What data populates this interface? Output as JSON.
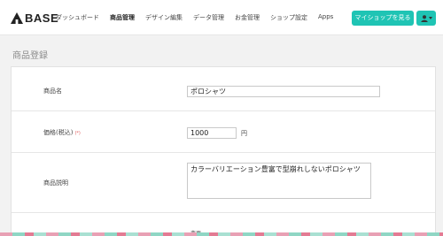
{
  "header": {
    "logo_text": "BASE",
    "nav": [
      {
        "label": "ダッシュボード",
        "active": false
      },
      {
        "label": "商品管理",
        "active": true
      },
      {
        "label": "デザイン編集",
        "active": false
      },
      {
        "label": "データ管理",
        "active": false
      },
      {
        "label": "お金管理",
        "active": false
      },
      {
        "label": "ショップ設定",
        "active": false
      },
      {
        "label": "Apps",
        "active": false
      }
    ],
    "shop_button_label": "マイショップを見る"
  },
  "page": {
    "title": "商品登録"
  },
  "form": {
    "product_name": {
      "label": "商品名",
      "value": "ポロシャツ"
    },
    "price": {
      "label": "価格(税込)",
      "required_mark": "(*)",
      "value": "1000",
      "unit": "円"
    },
    "description": {
      "label": "商品説明",
      "value": "カラーバリエーション豊富で型崩れしないポロシャツ"
    },
    "next_partial": {
      "text": "変更"
    }
  },
  "colors": {
    "accent": "#1fc4b4",
    "required": "#e05a5a"
  }
}
